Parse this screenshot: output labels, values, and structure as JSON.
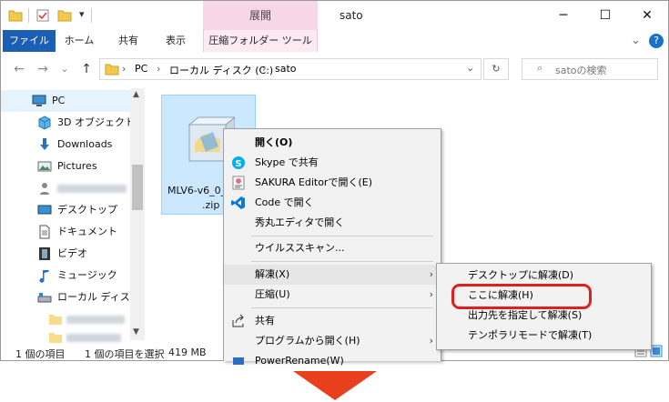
{
  "titlebar": {
    "context_tab": "展開",
    "title": "sato",
    "minimize": "─",
    "maximize": "☐",
    "close": "✕"
  },
  "ribbon": {
    "tabs": [
      "ファイル",
      "ホーム",
      "共有",
      "表示",
      "圧縮フォルダー ツール"
    ],
    "collapse": "⌄",
    "help": "?"
  },
  "address": {
    "back": "←",
    "forward": "→",
    "recent": "⌄",
    "up": "↑",
    "crumbs": [
      "PC",
      "ローカル ディスク (C:)",
      "sato"
    ],
    "sep": "›",
    "dropdown": "⌄",
    "refresh": "↻",
    "search_placeholder": "satoの検索",
    "search_icon": "⌕"
  },
  "sidebar": {
    "items": [
      {
        "label": "PC",
        "icon": "monitor-icon"
      },
      {
        "label": "3D オブジェクト",
        "icon": "cube-icon"
      },
      {
        "label": "Downloads",
        "icon": "download-icon"
      },
      {
        "label": "Pictures",
        "icon": "picture-icon"
      },
      {
        "label": "",
        "icon": "user-folder-icon"
      },
      {
        "label": "デスクトップ",
        "icon": "desktop-icon"
      },
      {
        "label": "ドキュメント",
        "icon": "document-icon"
      },
      {
        "label": "ビデオ",
        "icon": "film-icon"
      },
      {
        "label": "ミュージック",
        "icon": "music-icon"
      },
      {
        "label": "ローカル ディスク (",
        "icon": "disk-icon"
      },
      {
        "label": "",
        "icon": "folder-icon"
      },
      {
        "label": "",
        "icon": "folder-icon"
      }
    ]
  },
  "file": {
    "name_line1": "MLV6-v6_0_",
    "name_line2": ".zip"
  },
  "status": {
    "count": "1 個の項目",
    "selected": "1 個の項目を選択",
    "size": "419 MB"
  },
  "context_menu": {
    "items": [
      {
        "label": "開く(O)",
        "bold": true
      },
      {
        "label": "Skype で共有"
      },
      {
        "label": "SAKURA Editorで開く(E)"
      },
      {
        "label": "Code で開く"
      },
      {
        "label": "秀丸エディタで開く"
      },
      {
        "label": "ウイルススキャン..."
      },
      {
        "label": "解凍(X)",
        "submenu": true
      },
      {
        "label": "圧縮(U)",
        "submenu": true
      },
      {
        "label": "共有"
      },
      {
        "label": "プログラムから開く(H)",
        "submenu": true
      },
      {
        "label": "PowerRename(W)"
      }
    ],
    "arrow": "›"
  },
  "submenu": {
    "items": [
      {
        "label": "デスクトップに解凍(D)"
      },
      {
        "label": "ここに解凍(H)"
      },
      {
        "label": "出力先を指定して解凍(S)"
      },
      {
        "label": "テンポラリモードで解凍(T)"
      }
    ]
  },
  "colors": {
    "accent": "#1a5fb4",
    "context_tab": "#f7d7e7",
    "selection": "#cce8ff",
    "highlight": "#e02020",
    "arrow": "#e8401e"
  }
}
